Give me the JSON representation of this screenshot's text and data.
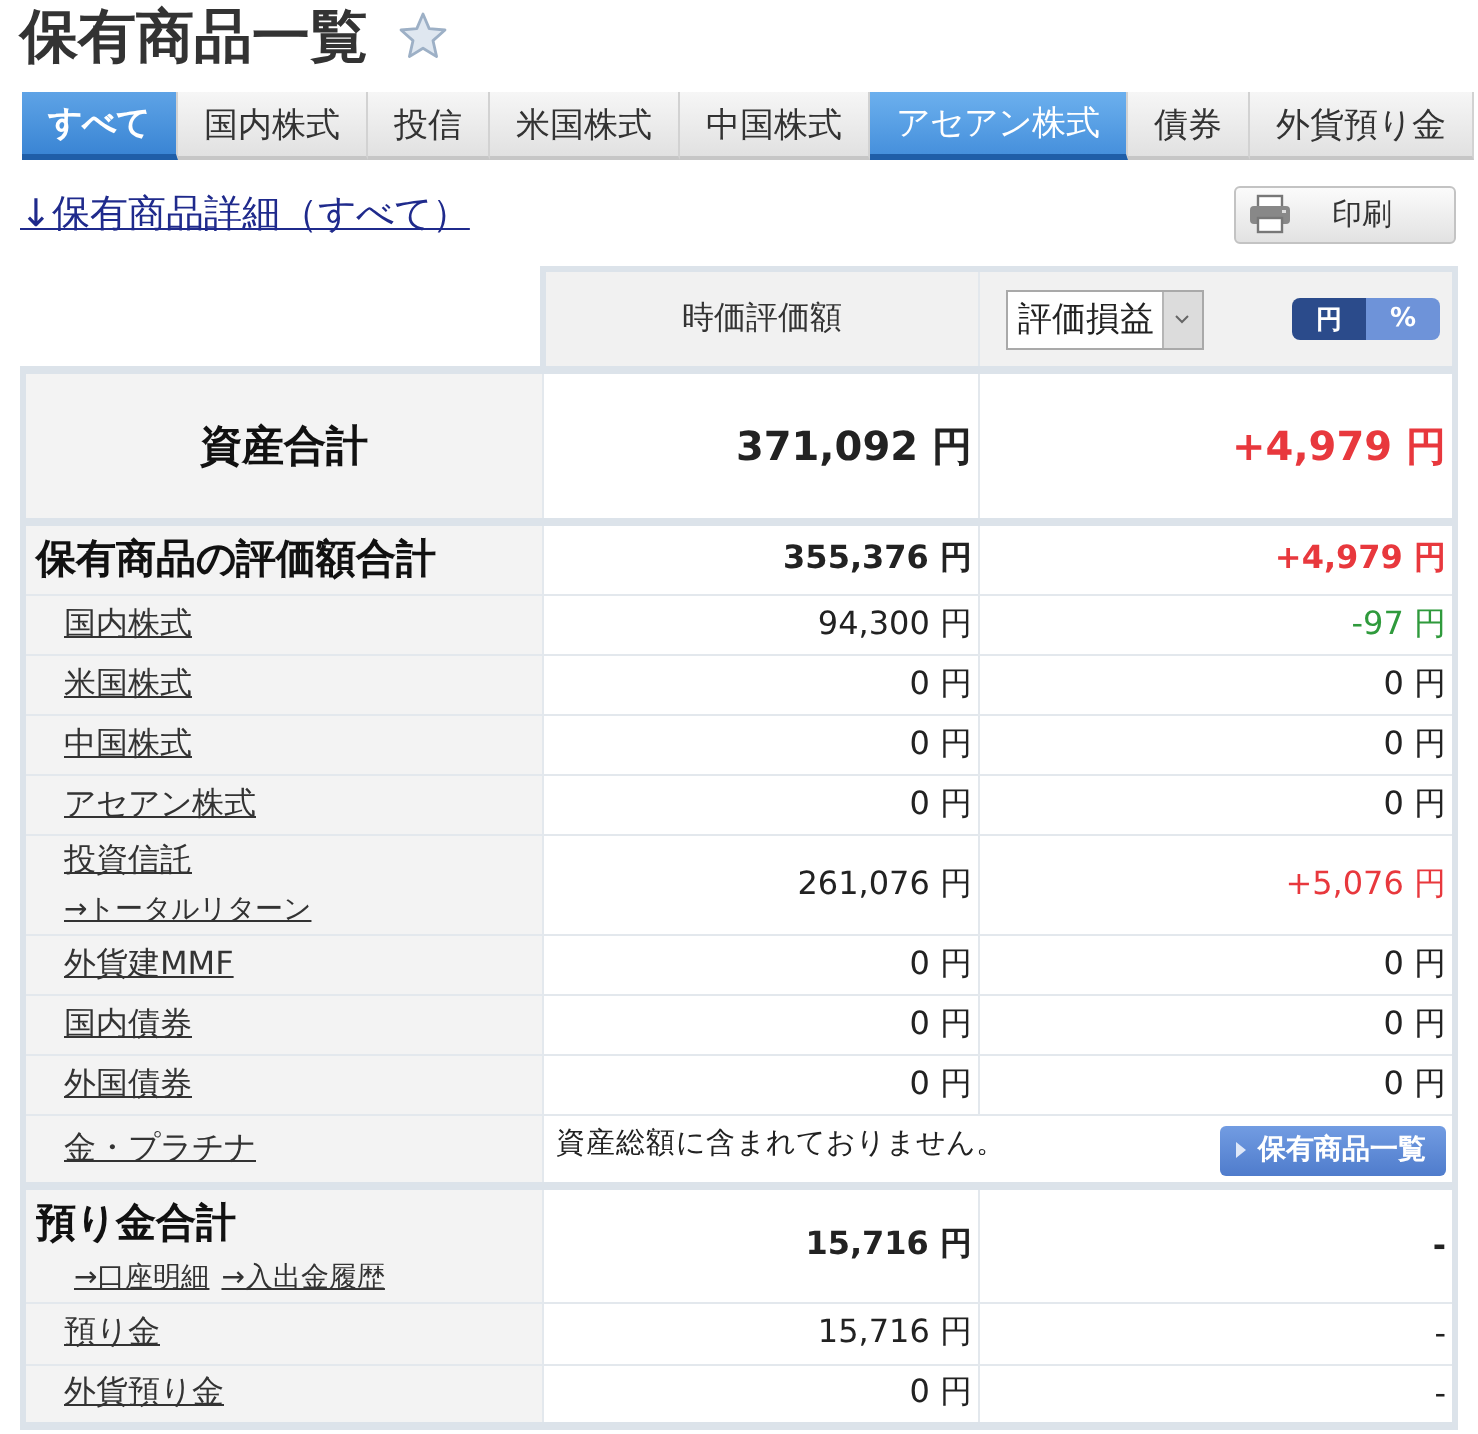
{
  "header": {
    "title": "保有商品一覧",
    "favorite": false
  },
  "tabs": [
    {
      "label": "すべて",
      "selected": true,
      "hovered": false
    },
    {
      "label": "国内株式",
      "selected": false,
      "hovered": false
    },
    {
      "label": "投信",
      "selected": false,
      "hovered": false
    },
    {
      "label": "米国株式",
      "selected": false,
      "hovered": false
    },
    {
      "label": "中国株式",
      "selected": false,
      "hovered": false
    },
    {
      "label": "アセアン株式",
      "selected": false,
      "hovered": true
    },
    {
      "label": "債券",
      "selected": false,
      "hovered": false
    },
    {
      "label": "外貨預り金",
      "selected": false,
      "hovered": false
    }
  ],
  "detail_link": "↓保有商品詳細（すべて）",
  "print_button": "印刷",
  "table": {
    "header": {
      "market_value": "時価評価額",
      "gain_select": "評価損益",
      "unit_toggle": [
        {
          "label": "円",
          "selected": true
        },
        {
          "label": "%",
          "selected": false
        }
      ]
    },
    "total": {
      "label": "資産合計",
      "market_value": "371,092 円",
      "gain": "+4,979 円",
      "color": "#e8383d"
    },
    "holdings": {
      "label": "保有商品の評価額合計",
      "market_value": "355,376 円",
      "gain": "+4,979 円",
      "color": "#e8383d",
      "rows": [
        {
          "kind": "value",
          "label": "国内株式",
          "market_value": "94,300 円",
          "gain": "-97 円",
          "color": "#2f9a3c"
        },
        {
          "kind": "value",
          "label": "米国株式",
          "market_value": "0 円",
          "gain": "0 円",
          "color": "#222222"
        },
        {
          "kind": "value",
          "label": "中国株式",
          "market_value": "0 円",
          "gain": "0 円",
          "color": "#222222"
        },
        {
          "kind": "value",
          "label": "アセアン株式",
          "market_value": "0 円",
          "gain": "0 円",
          "color": "#222222"
        },
        {
          "kind": "value",
          "label": "投資信託",
          "sublink": "→トータルリターン",
          "market_value": "261,076 円",
          "gain": "+5,076 円",
          "color": "#e8383d"
        },
        {
          "kind": "value",
          "label": "外貨建MMF",
          "market_value": "0 円",
          "gain": "0 円",
          "color": "#222222"
        },
        {
          "kind": "value",
          "label": "国内債券",
          "market_value": "0 円",
          "gain": "0 円",
          "color": "#222222"
        },
        {
          "kind": "value",
          "label": "外国債券",
          "market_value": "0 円",
          "gain": "0 円",
          "color": "#222222"
        },
        {
          "kind": "note",
          "label": "金・プラチナ",
          "note": "資産総額に含まれておりません。",
          "button": "保有商品一覧"
        }
      ]
    },
    "deposits": {
      "label": "預り金合計",
      "links": [
        "→口座明細",
        "→入出金履歴"
      ],
      "market_value": "15,716 円",
      "gain": "-",
      "color": "#222222",
      "rows": [
        {
          "kind": "value",
          "label": "預り金",
          "market_value": "15,716 円",
          "gain": "-",
          "color": "#222222"
        },
        {
          "kind": "value",
          "label": "外貨預り金",
          "market_value": "0 円",
          "gain": "-",
          "color": "#222222"
        }
      ]
    }
  }
}
